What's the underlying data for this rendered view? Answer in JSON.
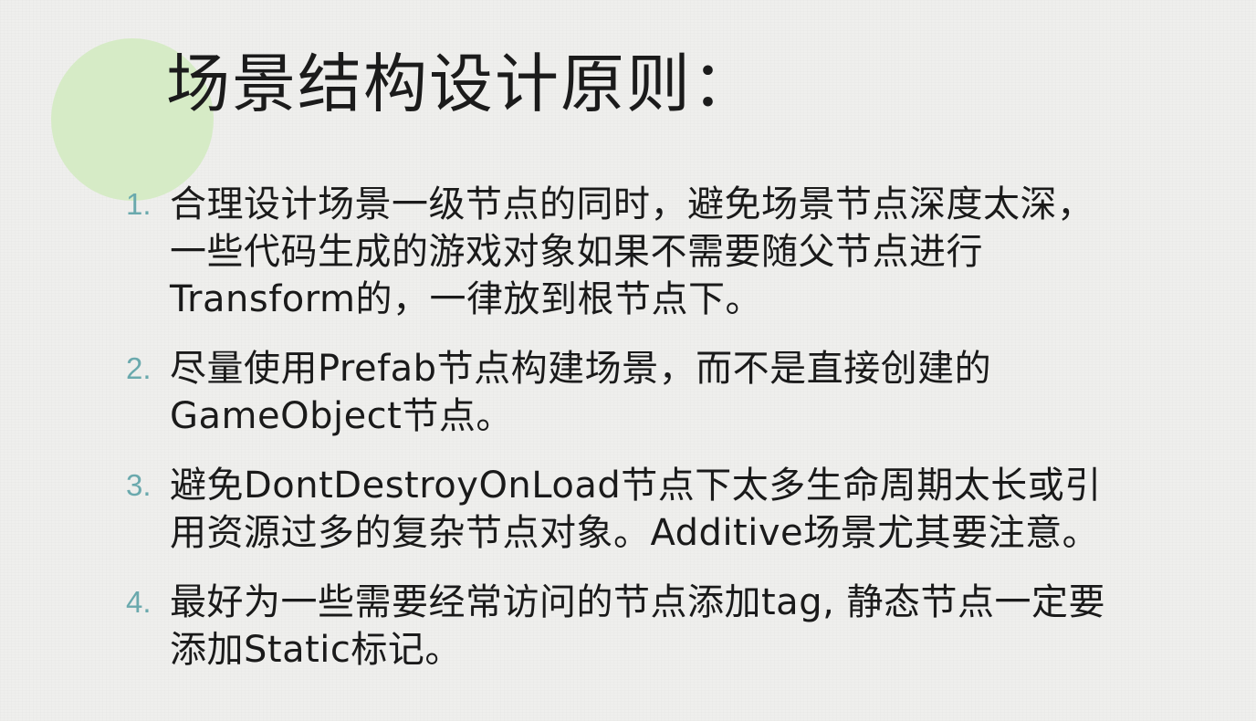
{
  "slide": {
    "title": "场景结构设计原则：",
    "accent_color": "#d6ebc6",
    "number_color": "#6aa9ad",
    "items": [
      {
        "number": "1.",
        "lines": [
          "合理设计场景一级节点的同时，避免场景节点深度太深，",
          "一些代码生成的游戏对象如果不需要随父节点进行",
          "Transform的，一律放到根节点下。"
        ]
      },
      {
        "number": "2.",
        "lines": [
          "尽量使用Prefab节点构建场景，而不是直接创建的",
          "GameObject节点。"
        ]
      },
      {
        "number": "3.",
        "lines": [
          "避免DontDestroyOnLoad节点下太多生命周期太长或引",
          "用资源过多的复杂节点对象。Additive场景尤其要注意。"
        ]
      },
      {
        "number": "4.",
        "lines": [
          "最好为一些需要经常访问的节点添加tag, 静态节点一定要",
          "添加Static标记。"
        ]
      }
    ]
  }
}
